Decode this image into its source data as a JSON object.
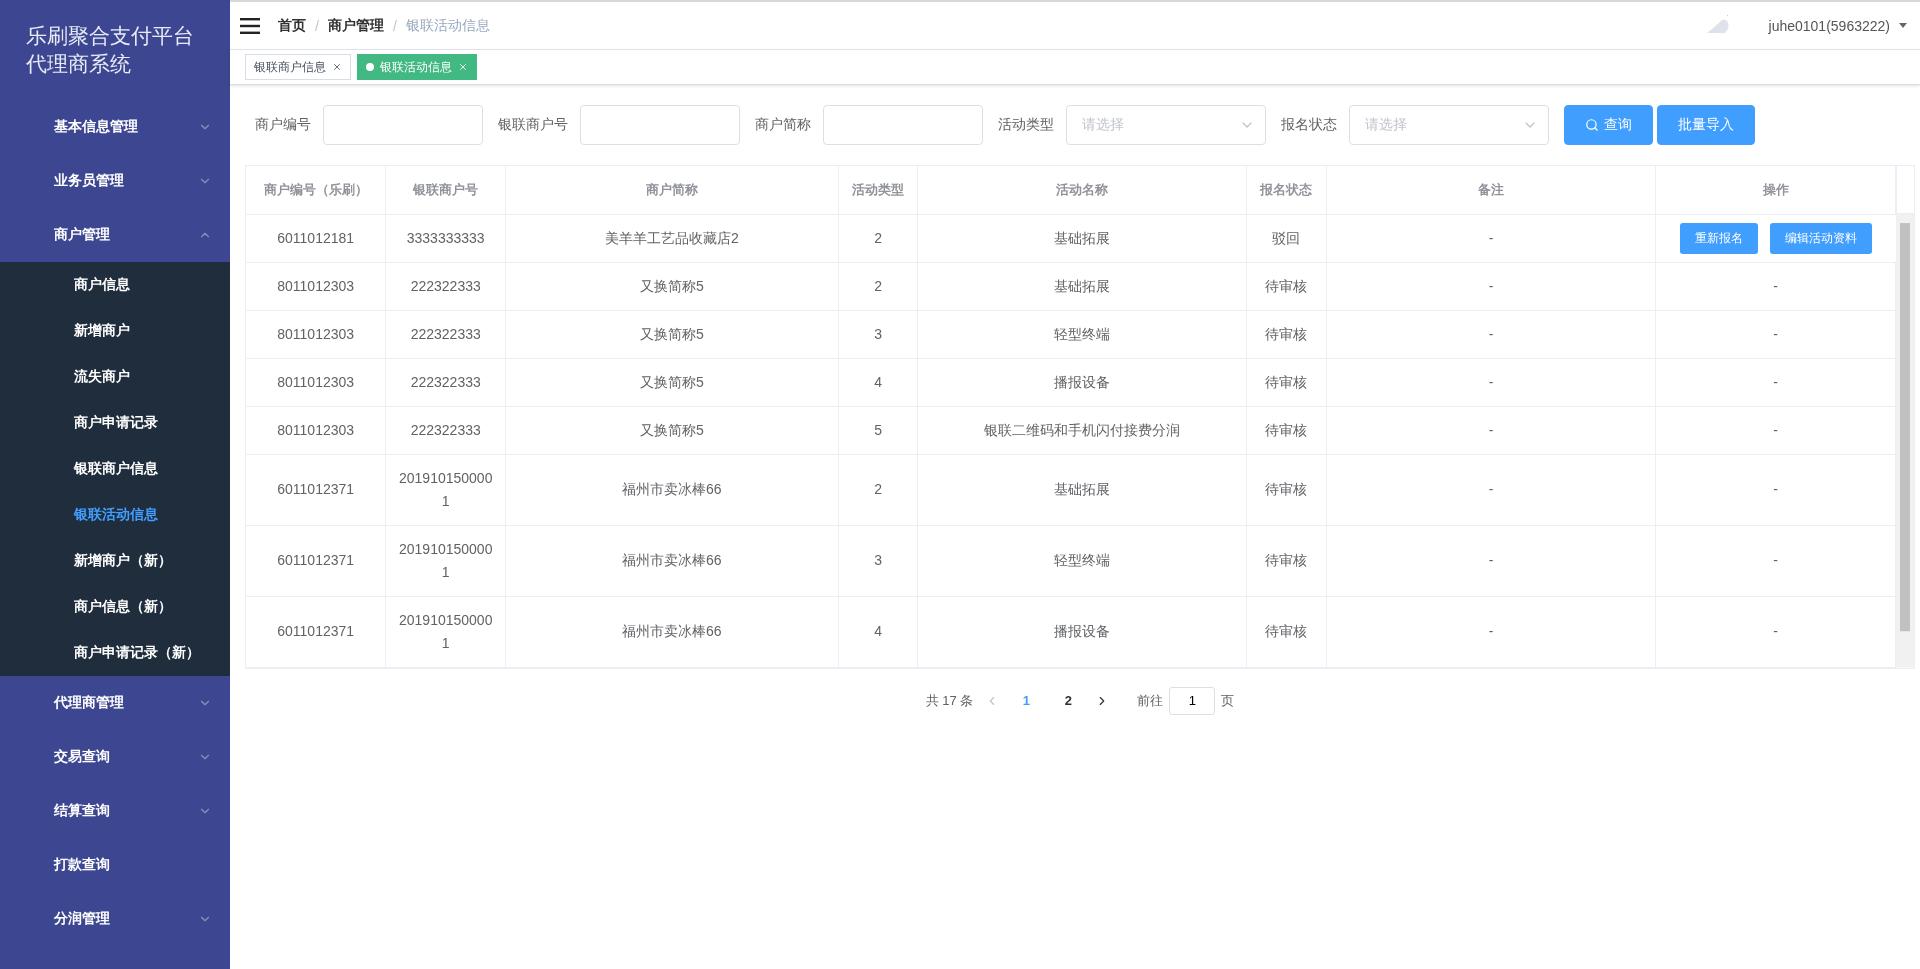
{
  "sidebar": {
    "title": [
      "乐刷聚合支付平台",
      "代理商系统"
    ],
    "menu": [
      {
        "label": "基本信息管理",
        "kind": "submenu",
        "expanded": false
      },
      {
        "label": "业务员管理",
        "kind": "submenu",
        "expanded": false
      },
      {
        "label": "商户管理",
        "kind": "submenu",
        "expanded": true,
        "children": [
          {
            "label": "商户信息",
            "selected": false
          },
          {
            "label": "新增商户",
            "selected": false
          },
          {
            "label": "流失商户",
            "selected": false
          },
          {
            "label": "商户申请记录",
            "selected": false
          },
          {
            "label": "银联商户信息",
            "selected": false
          },
          {
            "label": "银联活动信息",
            "selected": true
          },
          {
            "label": "新增商户（新）",
            "selected": false
          },
          {
            "label": "商户信息（新）",
            "selected": false
          },
          {
            "label": "商户申请记录（新）",
            "selected": false
          }
        ]
      },
      {
        "label": "代理商管理",
        "kind": "submenu",
        "expanded": false
      },
      {
        "label": "交易查询",
        "kind": "submenu",
        "expanded": false
      },
      {
        "label": "结算查询",
        "kind": "submenu",
        "expanded": false
      },
      {
        "label": "打款查询",
        "kind": "item"
      },
      {
        "label": "分润管理",
        "kind": "submenu",
        "expanded": false
      }
    ]
  },
  "header": {
    "breadcrumb": [
      "首页",
      "商户管理",
      "银联活动信息"
    ],
    "separator": "/",
    "user": "juhe0101(5963222)"
  },
  "tags": [
    {
      "label": "银联商户信息",
      "selected": false
    },
    {
      "label": "银联活动信息",
      "selected": true
    }
  ],
  "filters": [
    {
      "label": "商户编号",
      "kind": "input"
    },
    {
      "label": "银联商户号",
      "kind": "input"
    },
    {
      "label": "商户简称",
      "kind": "input"
    },
    {
      "label": "活动类型",
      "kind": "select",
      "placeholder": "请选择"
    },
    {
      "label": "报名状态",
      "kind": "select",
      "placeholder": "请选择"
    }
  ],
  "filter_buttons": [
    {
      "label": "查询",
      "kind": "search"
    },
    {
      "label": "批量导入",
      "kind": "plain"
    }
  ],
  "table": {
    "columns": [
      "商户编号（乐刷）",
      "银联商户号",
      "商户简称",
      "活动类型",
      "活动名称",
      "报名状态",
      "备注",
      "操作"
    ],
    "rows": [
      {
        "cells": [
          "6011012181",
          "3333333333",
          "美羊羊工艺品收藏店2",
          "2",
          "基础拓展",
          "驳回",
          "-"
        ],
        "operation": {
          "kind": "buttons",
          "buttons": [
            "重新报名",
            "编辑活动资料"
          ]
        }
      },
      {
        "cells": [
          "8011012303",
          "222322333",
          "又换简称5",
          "2",
          "基础拓展",
          "待审核",
          "-"
        ],
        "operation": {
          "kind": "text",
          "text": "-"
        }
      },
      {
        "cells": [
          "8011012303",
          "222322333",
          "又换简称5",
          "3",
          "轻型终端",
          "待审核",
          "-"
        ],
        "operation": {
          "kind": "text",
          "text": "-"
        }
      },
      {
        "cells": [
          "8011012303",
          "222322333",
          "又换简称5",
          "4",
          "播报设备",
          "待审核",
          "-"
        ],
        "operation": {
          "kind": "text",
          "text": "-"
        }
      },
      {
        "cells": [
          "8011012303",
          "222322333",
          "又换简称5",
          "5",
          "银联二维码和手机闪付接费分润",
          "待审核",
          "-"
        ],
        "operation": {
          "kind": "text",
          "text": "-"
        }
      },
      {
        "cells": [
          "6011012371",
          "2019101500001",
          "福州市卖冰棒66",
          "2",
          "基础拓展",
          "待审核",
          "-"
        ],
        "operation": {
          "kind": "text",
          "text": "-"
        }
      },
      {
        "cells": [
          "6011012371",
          "2019101500001",
          "福州市卖冰棒66",
          "3",
          "轻型终端",
          "待审核",
          "-"
        ],
        "operation": {
          "kind": "text",
          "text": "-"
        }
      },
      {
        "cells": [
          "6011012371",
          "2019101500001",
          "福州市卖冰棒66",
          "4",
          "播报设备",
          "待审核",
          "-"
        ],
        "operation": {
          "kind": "text",
          "text": "-"
        }
      }
    ]
  },
  "pagination": {
    "total": "共 17 条",
    "prev_disabled": true,
    "pages": [
      {
        "label": "1",
        "selected": true
      },
      {
        "label": "2",
        "selected": false
      }
    ],
    "goto_label": "前往",
    "goto_value": "1",
    "page_unit": "页"
  }
}
